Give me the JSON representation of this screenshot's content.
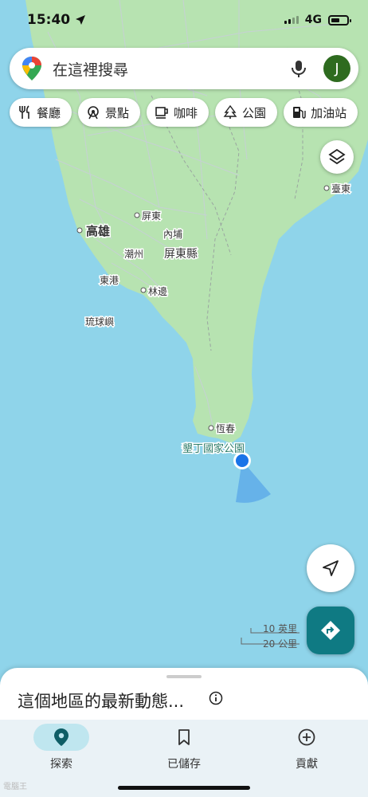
{
  "status_bar": {
    "time": "15:40",
    "network": "4G"
  },
  "search": {
    "placeholder": "在這裡搜尋",
    "avatar_letter": "J"
  },
  "chips": [
    {
      "label": "餐廳",
      "icon": "fork-knife-icon"
    },
    {
      "label": "景點",
      "icon": "attraction-icon"
    },
    {
      "label": "咖啡",
      "icon": "coffee-icon"
    },
    {
      "label": "公園",
      "icon": "tree-icon"
    },
    {
      "label": "加油站",
      "icon": "gas-station-icon"
    }
  ],
  "map_labels": {
    "kaohsiung": "高雄",
    "pingtung_city": "屏東",
    "neipu": "內埔",
    "chaozhou": "潮州",
    "pingtung_county": "屏東縣",
    "donggang": "東港",
    "linbian": "林邊",
    "liuqiu": "琉球嶼",
    "taitung": "臺東",
    "hengchun": "恆春",
    "kenting": "墾丁國家公園"
  },
  "scale": {
    "imperial": "10 英里",
    "metric": "20 公里"
  },
  "sheet": {
    "title": "這個地區的最新動態..."
  },
  "nav": [
    {
      "label": "探索",
      "icon": "explore-pin-icon",
      "active": true
    },
    {
      "label": "已儲存",
      "icon": "bookmark-icon",
      "active": false
    },
    {
      "label": "貢獻",
      "icon": "add-circle-icon",
      "active": false
    }
  ],
  "watermark": "電腦王",
  "colors": {
    "water": "#8fd4ea",
    "land": "#b7e3b1",
    "accent": "#0f7a83",
    "location_dot": "#1a73e8"
  }
}
